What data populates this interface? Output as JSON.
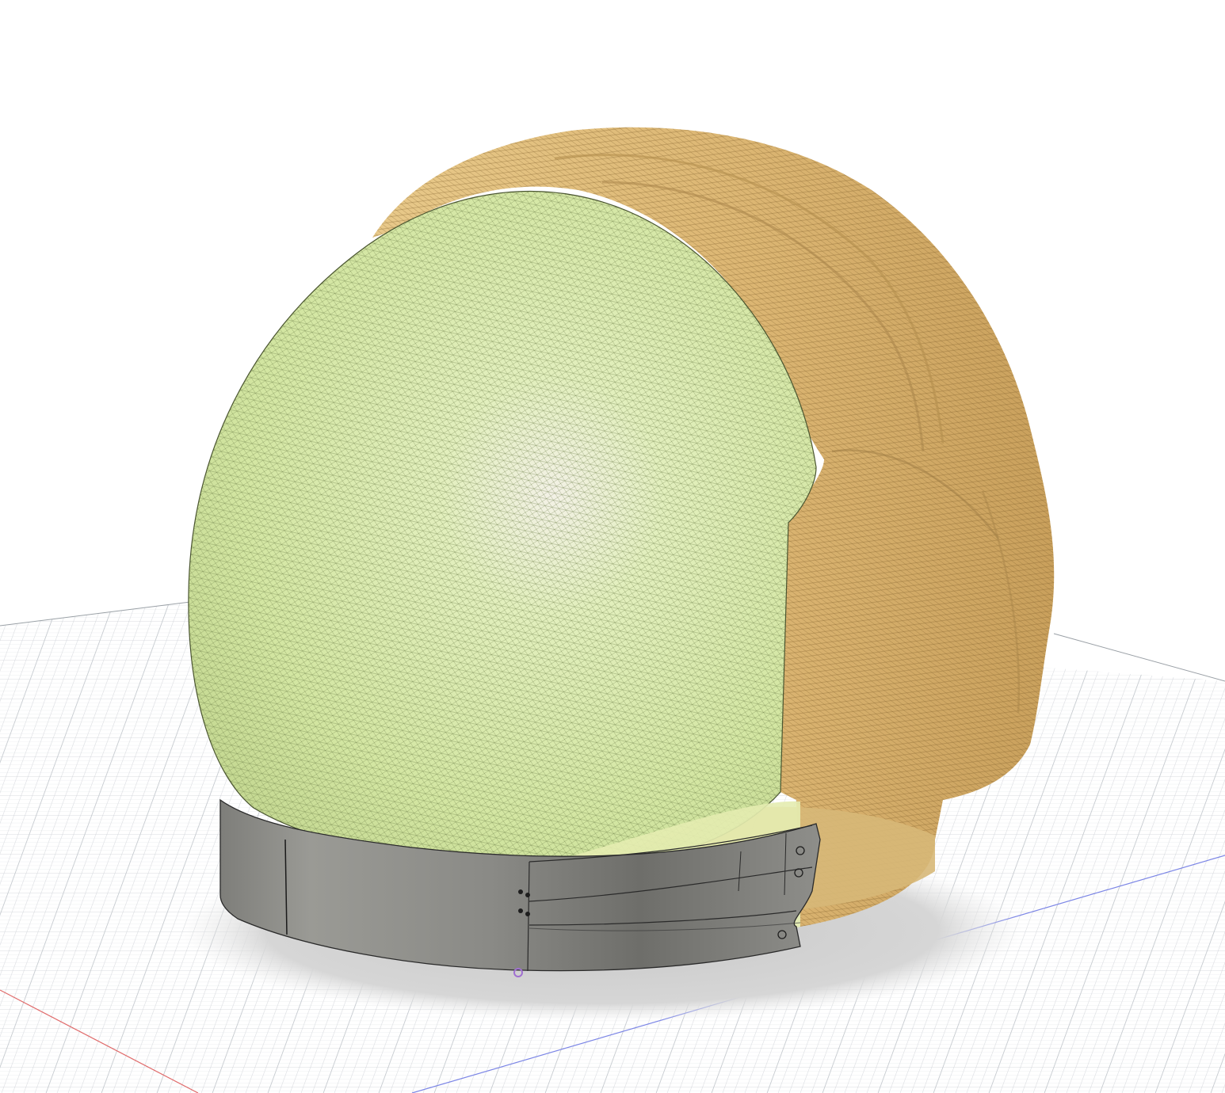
{
  "viewport": {
    "background": "#ffffff",
    "grid_color": "#d2d6da",
    "grid_major_color": "#bcc1c6",
    "x_axis_color": "#e06a6a",
    "y_axis_color": "#7c86e6"
  },
  "model": {
    "visor_color": "#d9ebae",
    "visor_mesh_color": "#5f6f3e",
    "hood_color": "#e0bd7b",
    "hood_mesh_color": "#7a5c2a",
    "band_color": "#8c8c88",
    "band_edge_color": "#2a2a2a",
    "shadow_color": "#d5d5d5",
    "pivot_marker_color": "#a070d0"
  },
  "icons": {
    "pivot": "pivot-marker-icon"
  }
}
